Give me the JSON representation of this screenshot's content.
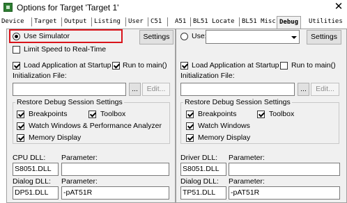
{
  "window": {
    "title": "Options for Target 'Target 1'",
    "close_glyph": "✕"
  },
  "tabs": [
    "Device",
    "Target",
    "Output",
    "Listing",
    "User",
    "C51",
    "A51",
    "BL51 Locate",
    "BL51 Misc",
    "Debug",
    "Utilities"
  ],
  "selected_tab": "Debug",
  "left": {
    "use_simulator_label": "Use Simulator",
    "settings_label": "Settings",
    "limit_speed_label": "Limit Speed to Real-Time",
    "load_app_label": "Load Application at Startup",
    "run_main_label": "Run to main()",
    "init_file_label": "Initialization File:",
    "init_file_value": "",
    "browse_label": "...",
    "edit_label": "Edit...",
    "restore_group_label": "Restore Debug Session Settings",
    "breakpoints_label": "Breakpoints",
    "toolbox_label": "Toolbox",
    "watch_label": "Watch Windows & Performance Analyzer",
    "memory_label": "Memory Display",
    "cpu_dll_label": "CPU DLL:",
    "cpu_param_label": "Parameter:",
    "cpu_dll_value": "S8051.DLL",
    "cpu_param_value": "",
    "dialog_dll_label": "Dialog DLL:",
    "dialog_param_label": "Parameter:",
    "dialog_dll_value": "DP51.DLL",
    "dialog_param_value": "-pAT51R"
  },
  "right": {
    "use_label": "Use:",
    "use_value": "",
    "settings_label": "Settings",
    "load_app_label": "Load Application at Startup",
    "run_main_label": "Run to main()",
    "init_file_label": "Initialization File:",
    "init_file_value": "",
    "browse_label": "...",
    "edit_label": "Edit...",
    "restore_group_label": "Restore Debug Session Settings",
    "breakpoints_label": "Breakpoints",
    "toolbox_label": "Toolbox",
    "watch_label": "Watch Windows",
    "memory_label": "Memory Display",
    "driver_dll_label": "Driver DLL:",
    "driver_param_label": "Parameter:",
    "driver_dll_value": "S8051.DLL",
    "driver_param_value": "",
    "dialog_dll_label": "Dialog DLL:",
    "dialog_param_label": "Parameter:",
    "dialog_dll_value": "TP51.DLL",
    "dialog_param_value": "-pAT51R"
  },
  "colors": {
    "highlight": "#d9131a",
    "panel": "#f0f0f0"
  }
}
